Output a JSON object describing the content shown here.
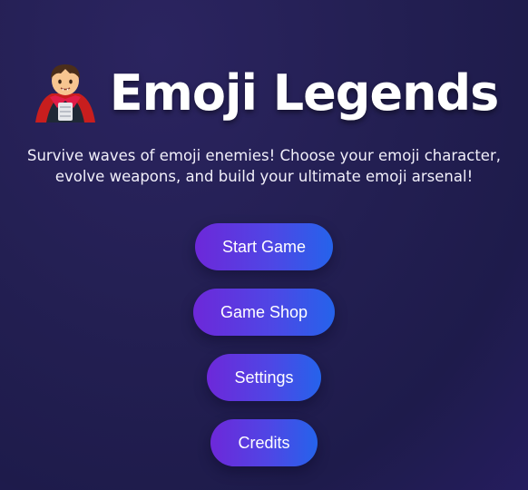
{
  "title": {
    "icon": "vampire-emoji-icon",
    "text": "Emoji Legends"
  },
  "subtitle": "Survive waves of emoji enemies! Choose your emoji character, evolve weapons, and build your ultimate emoji arsenal!",
  "menu": {
    "start_label": "Start Game",
    "shop_label": "Game Shop",
    "settings_label": "Settings",
    "credits_label": "Credits"
  },
  "colors": {
    "background": "#231f52",
    "button_start": "#6d28d9",
    "button_end": "#2563eb",
    "text": "#ffffff"
  }
}
